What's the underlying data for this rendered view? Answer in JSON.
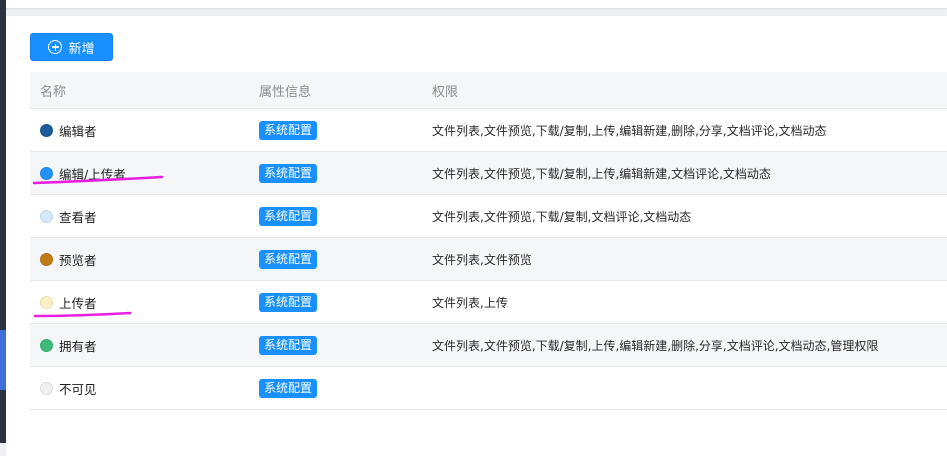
{
  "toolbar": {
    "add_label": "新增",
    "add_icon": "plus-circle-icon"
  },
  "table": {
    "headers": [
      "名称",
      "属性信息",
      "权限"
    ],
    "rows": [
      {
        "name": "编辑者",
        "color": "#1a5c99",
        "attr": "系统配置",
        "perms": "文件列表,文件预览,下载/复制,上传,编辑新建,删除,分享,文档评论,文档动态"
      },
      {
        "name": "编辑/上传者",
        "color": "#2491f5",
        "attr": "系统配置",
        "perms": "文件列表,文件预览,下载/复制,上传,编辑新建,文档评论,文档动态"
      },
      {
        "name": "查看者",
        "color": "#d3e8fb",
        "attr": "系统配置",
        "perms": "文件列表,文件预览,下载/复制,文档评论,文档动态"
      },
      {
        "name": "预览者",
        "color": "#c07a12",
        "attr": "系统配置",
        "perms": "文件列表,文件预览"
      },
      {
        "name": "上传者",
        "color": "#fdf0c4",
        "attr": "系统配置",
        "perms": "文件列表,上传"
      },
      {
        "name": "拥有者",
        "color": "#3dba7a",
        "attr": "系统配置",
        "perms": "文件列表,文件预览,下载/复制,上传,编辑新建,删除,分享,文档评论,文档动态,管理权限"
      },
      {
        "name": "不可见",
        "color": "#f1f1f1",
        "attr": "系统配置",
        "perms": ""
      }
    ]
  },
  "colors": {
    "primary": "#1890ff",
    "annotation": "#e81ee0"
  }
}
